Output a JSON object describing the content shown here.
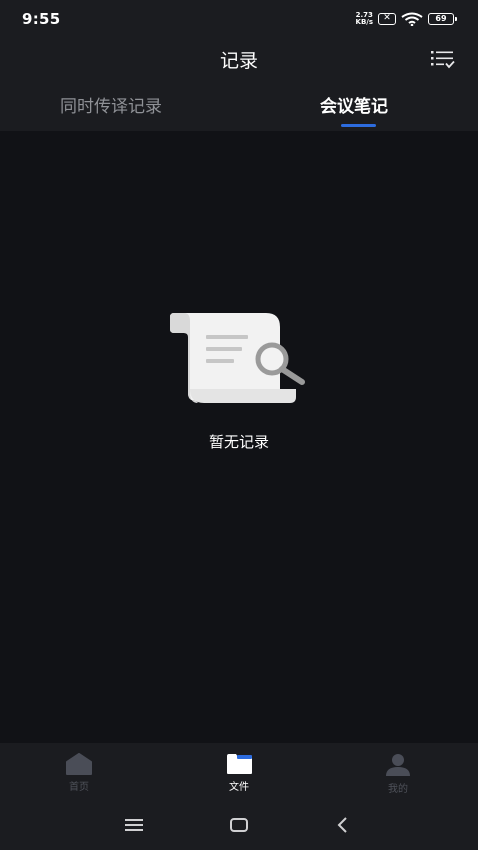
{
  "status_bar": {
    "time": "9:55",
    "net_speed_value": "2.73",
    "net_speed_unit": "KB/s",
    "sim_label": "✕",
    "battery_level": "69"
  },
  "header": {
    "title": "记录",
    "filter_icon": "filter-list-icon"
  },
  "tabs": [
    {
      "label": "同时传译记录",
      "active": false
    },
    {
      "label": "会议笔记",
      "active": true
    }
  ],
  "empty_state": {
    "icon": "document-search-icon",
    "text": "暂无记录"
  },
  "bottom_nav": [
    {
      "label": "首页",
      "icon": "home-icon",
      "active": false
    },
    {
      "label": "文件",
      "icon": "folder-icon",
      "active": true
    },
    {
      "label": "我的",
      "icon": "person-icon",
      "active": false
    }
  ],
  "colors": {
    "background": "#111216",
    "bar_background": "#1b1c20",
    "accent": "#2d6cdf",
    "inactive_text": "#8f9196",
    "inactive_nav": "#4f525a"
  }
}
